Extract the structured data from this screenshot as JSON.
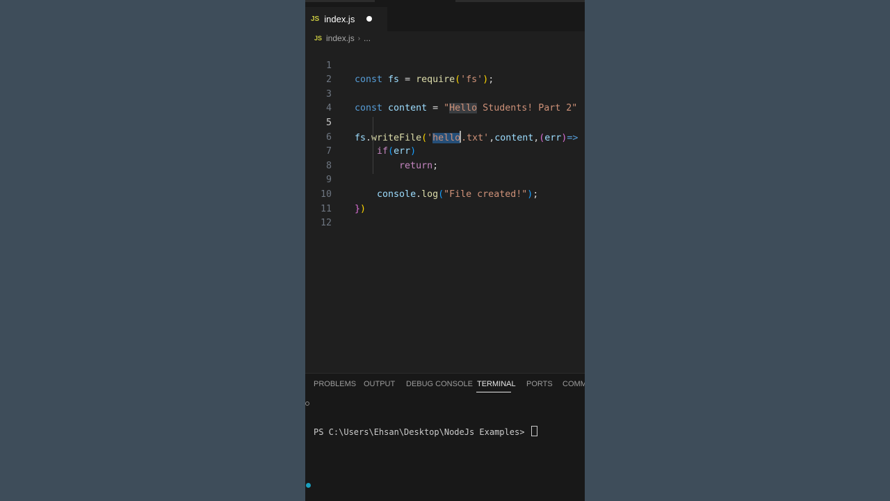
{
  "tab": {
    "icon": "JS",
    "filename": "index.js"
  },
  "breadcrumb": {
    "icon": "JS",
    "file": "index.js",
    "separator": "›",
    "more": "..."
  },
  "code": {
    "line_numbers": [
      "1",
      "2",
      "3",
      "4",
      "5",
      "6",
      "7",
      "8",
      "9",
      "10",
      "11",
      "12"
    ],
    "l1": {
      "kw": "const",
      "var": "fs",
      "eq": " = ",
      "fn": "require",
      "open": "(",
      "str": "'fs'",
      "close": ")",
      "semi": ";"
    },
    "l3": {
      "kw": "const",
      "var": "content",
      "eq": " = ",
      "str_q": "\"",
      "str_hl": "Hello",
      "str_rest": " Students! Part 2\""
    },
    "l5": {
      "obj": "fs",
      "dot": ".",
      "fn": "writeFile",
      "open": "(",
      "q": "'",
      "sel": "hello",
      "rest": ".txt'",
      "comma": ",",
      "arg": "content",
      "comma2": ",",
      "open2": "(",
      "err": "err",
      "close2": ")",
      "arrow": "=>"
    },
    "l6": {
      "kw": "if",
      "open": "(",
      "var": "err",
      "close": ")"
    },
    "l7": {
      "kw": "return",
      "semi": ";"
    },
    "l9": {
      "obj": "console",
      "dot": ".",
      "fn": "log",
      "open": "(",
      "str": "\"File created!\"",
      "close": ")",
      "semi": ";"
    },
    "l10": {
      "brace": "}",
      "paren": ")"
    }
  },
  "panel": {
    "tabs": [
      "PROBLEMS",
      "OUTPUT",
      "DEBUG CONSOLE",
      "TERMINAL",
      "PORTS",
      "COMM"
    ],
    "active_tab": "TERMINAL",
    "prompt": "PS C:\\Users\\Ehsan\\Desktop\\NodeJs Examples> "
  },
  "colors": {
    "keyword": "#569cd6",
    "variable": "#9cdcfe",
    "function": "#dcdcaa",
    "string": "#ce9178",
    "selection": "#264f78"
  }
}
